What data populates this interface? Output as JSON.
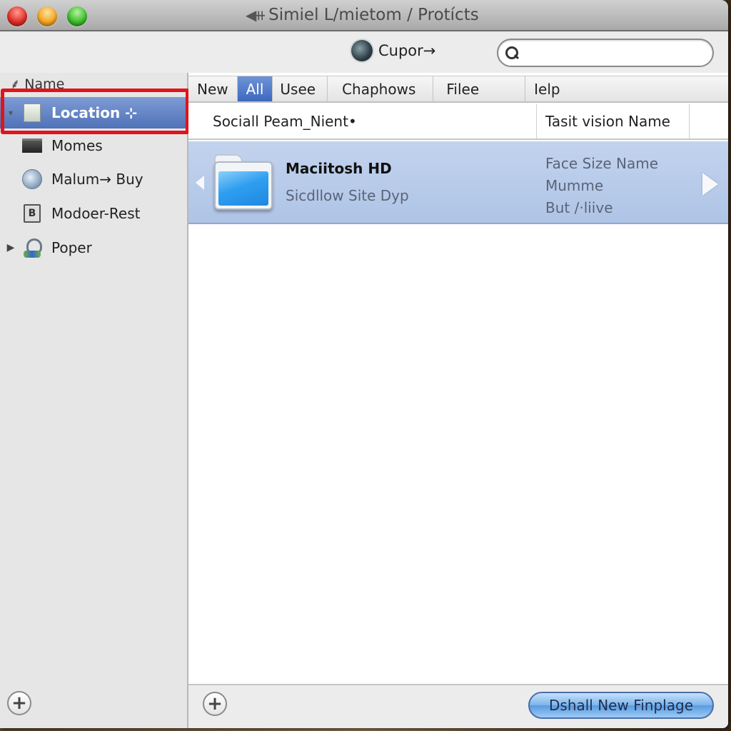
{
  "window": {
    "title": "Simiel L/mietom / Protícts",
    "title_icon": "back-forward-icon"
  },
  "toolbar": {
    "action_label": "Cupor→",
    "action_icon": "gear-icon",
    "search": {
      "value": "",
      "placeholder": ""
    }
  },
  "sidebar": {
    "header": "Name",
    "items": [
      {
        "label": "Location ⊹",
        "icon": "document-icon",
        "selected": true
      },
      {
        "label": "Momes",
        "icon": "box-icon"
      },
      {
        "label": "Malum→ Buy",
        "icon": "globe-icon"
      },
      {
        "label": "Modoer-Rest",
        "icon": "drive-icon"
      },
      {
        "label": "Poper",
        "icon": "user-icon",
        "collapsed": true
      }
    ],
    "add_label": "+"
  },
  "main": {
    "tabs": [
      {
        "label": "New"
      },
      {
        "label": "All",
        "active": true
      },
      {
        "label": "Usee"
      },
      {
        "label": "Chaphows"
      },
      {
        "label": "Filee"
      },
      {
        "label": "Ielp"
      }
    ],
    "columns": [
      "Sociall Peam_Nient•",
      "Tasit vision Name"
    ],
    "rows": [
      {
        "name": "Maciitosh HD",
        "subtitle": "Sicdllow Site Dyp",
        "meta": [
          "Face Size Name",
          "Mumme",
          "But /·liive"
        ],
        "icon": "folder-icon",
        "selected": true
      }
    ],
    "add_label": "+",
    "primary_button": "Dshall New  Finplage"
  }
}
